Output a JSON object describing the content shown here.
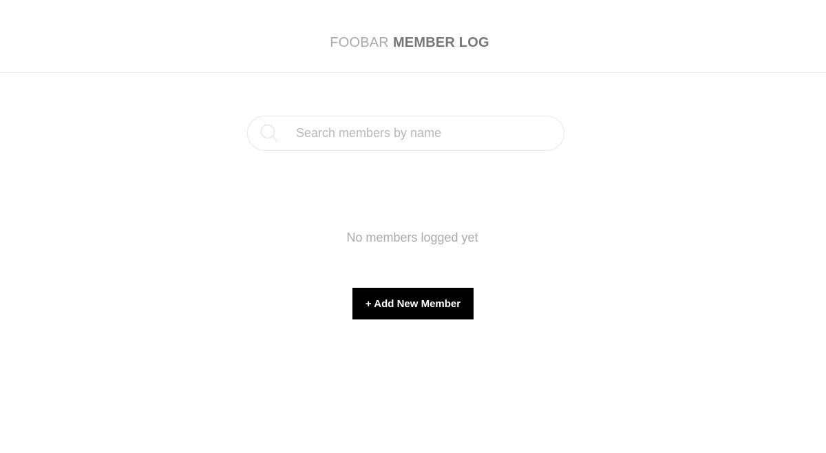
{
  "header": {
    "title_light": "FOOBAR",
    "title_bold": "MEMBER LOG"
  },
  "search": {
    "placeholder": "Search members by name",
    "value": "",
    "icon": "search-icon"
  },
  "main": {
    "empty_message": "No members logged yet",
    "add_button_label": "+ Add New Member"
  }
}
